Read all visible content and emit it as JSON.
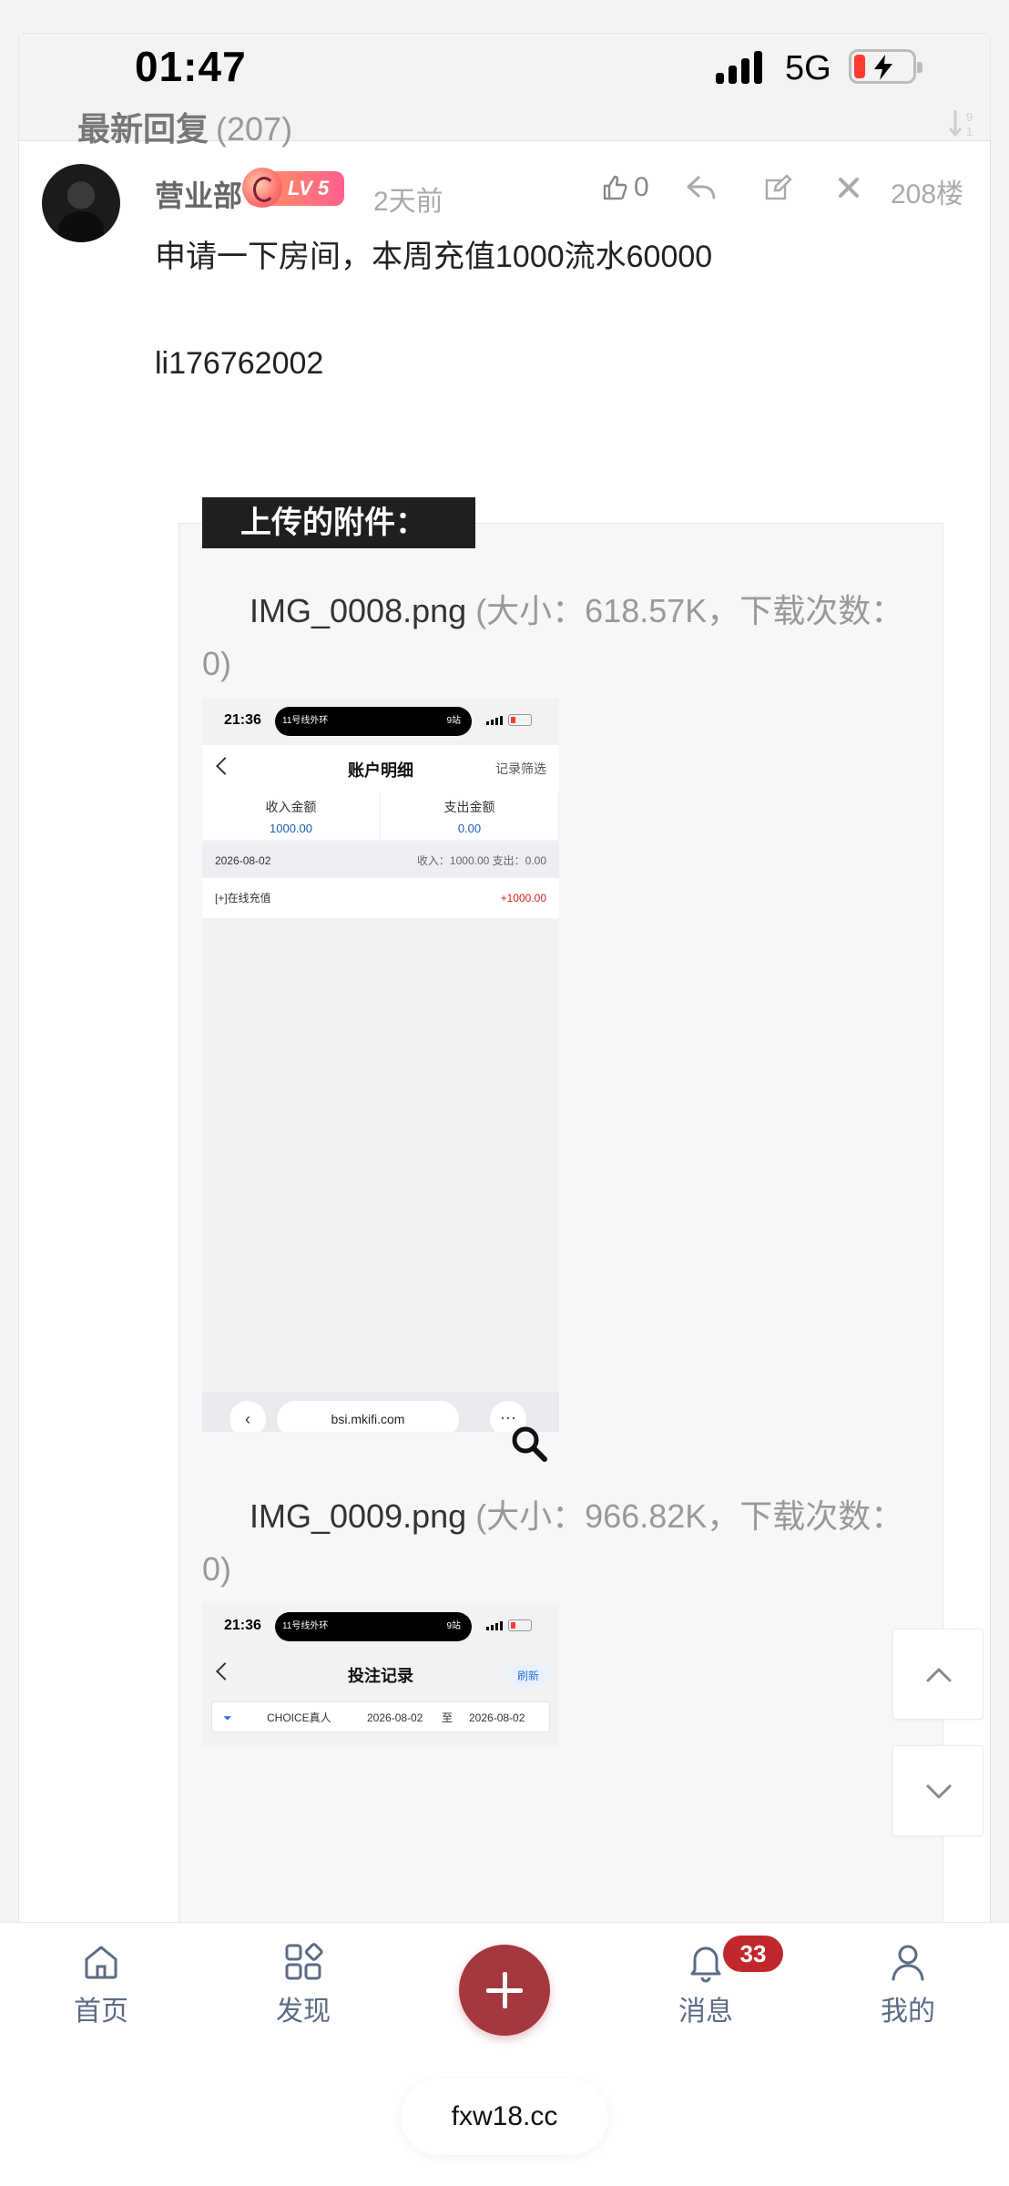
{
  "status_bar": {
    "time": "01:47",
    "network": "5G"
  },
  "section": {
    "title": "最新回复",
    "count": "(207)"
  },
  "sort_icon": "sort-desc-icon",
  "post": {
    "username": "营业部",
    "level_badge": "LV 5",
    "time": "2天前",
    "likes": "0",
    "floor": "208楼",
    "line1": "申请一下房间，本周充值1000流水60000",
    "line2": "li176762002"
  },
  "attachments": {
    "label": "上传的附件：",
    "items": [
      {
        "name": "IMG_0008.png",
        "meta": "(大小：618.57K，下载次数：0)"
      },
      {
        "name": "IMG_0009.png",
        "meta": "(大小：966.82K，下载次数：0)"
      }
    ]
  },
  "shot1": {
    "time": "21:36",
    "island_left": "11号线外环",
    "island_right": "9站",
    "title": "账户明细",
    "filter": "记录筛选",
    "income_label": "收入金额",
    "income_value": "1000.00",
    "expense_label": "支出金额",
    "expense_value": "0.00",
    "date": "2026-08-02",
    "day_summary": "收入：1000.00  支出：0.00",
    "entry_label": "[+]在线充值",
    "entry_amount": "+1000.00",
    "url": "bsi.mkifi.com"
  },
  "shot2": {
    "time": "21:36",
    "island_left": "11号线外环",
    "island_right": "9站",
    "title": "投注记录",
    "refresh": "刷新",
    "game": "CHOICE真人",
    "from": "2026-08-02",
    "to_word": "至",
    "to": "2026-08-02"
  },
  "tabbar": {
    "home": "首页",
    "discover": "发现",
    "messages": "消息",
    "messages_badge": "33",
    "mine": "我的"
  },
  "site_url": "fxw18.cc",
  "colors": {
    "accent": "#a5373e",
    "badge": "#c0272d",
    "tab_label": "#5c6b85"
  }
}
